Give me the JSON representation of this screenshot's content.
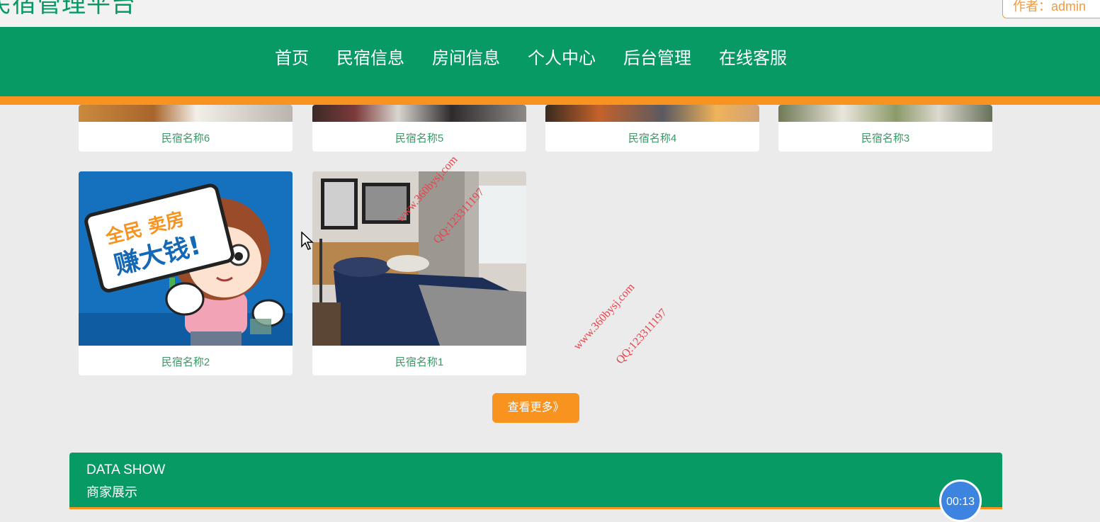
{
  "header": {
    "site_title": "民宿管理平台",
    "author_label": "作者：admin"
  },
  "nav": {
    "items": [
      "首页",
      "民宿信息",
      "房间信息",
      "个人中心",
      "后台管理",
      "在线客服"
    ]
  },
  "listings_row1": [
    "民宿名称6",
    "民宿名称5",
    "民宿名称4",
    "民宿名称3"
  ],
  "listings_row2": [
    "民宿名称2",
    "民宿名称1"
  ],
  "more_button": "查看更多》",
  "data_show": {
    "title": "DATA SHOW",
    "subtitle": "商家展示"
  },
  "watermarks": [
    "www.360bysj.com",
    "QQ:123311197"
  ],
  "poster_text": {
    "line1": "全民 卖房",
    "line2": "赚大钱!"
  },
  "timer": "00:13",
  "colors": {
    "brand_green": "#079a64",
    "accent_orange": "#f7931e",
    "link_green": "#3a9a66"
  }
}
